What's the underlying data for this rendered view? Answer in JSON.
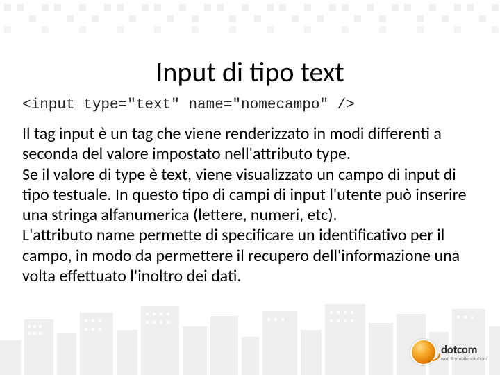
{
  "title": "Input di tipo text",
  "code": "<input type=\"text\" name=\"nomecampo\" />",
  "body": "Il tag input è un tag che viene renderizzato in modi differenti a seconda del valore impostato nell'attributo type.\nSe il valore di type è text, viene visualizzato un campo di input di tipo testuale. In questo tipo di campi di input l'utente può inserire una stringa alfanumerica (lettere, numeri, etc).\nL'attributo name permette di specificare un identificativo per il campo, in modo da permettere il recupero dell'informazione una volta effettuato l'inoltro dei dati.",
  "logo": {
    "name": "dotcom",
    "tagline": "web & mobile solutions"
  }
}
